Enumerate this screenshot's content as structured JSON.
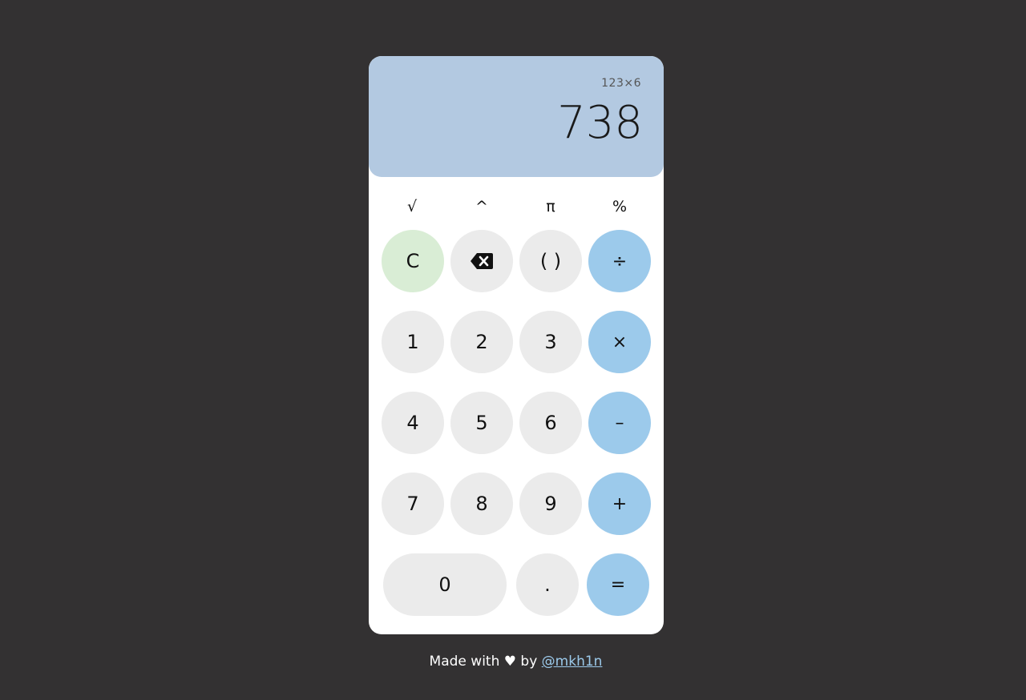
{
  "display": {
    "expression": "123×6",
    "result": "738"
  },
  "functions": [
    "√",
    "^",
    "π",
    "%"
  ],
  "keys": {
    "clear": "C",
    "backspace_icon": "backspace-icon",
    "parens": "( )",
    "divide": "÷",
    "one": "1",
    "two": "2",
    "three": "3",
    "multiply": "×",
    "four": "4",
    "five": "5",
    "six": "6",
    "minus": "–",
    "seven": "7",
    "eight": "8",
    "nine": "9",
    "plus": "+",
    "zero": "0",
    "decimal": ".",
    "equals": "="
  },
  "colors": {
    "background": "#333132",
    "display": "#b3c9e1",
    "digit_key": "#ebebeb",
    "clear_key": "#d9edd5",
    "operator_key": "#9ccaeb"
  },
  "footer": {
    "text": "Made with ♥ by",
    "link": "@mkh1n"
  }
}
